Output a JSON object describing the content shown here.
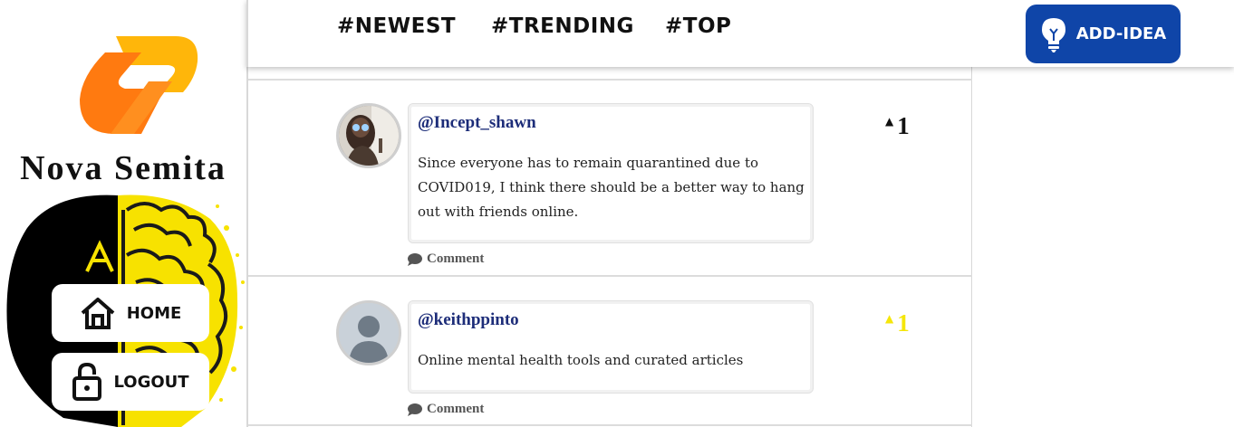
{
  "brand": {
    "name": "Nova Semita"
  },
  "sidebar": {
    "items": [
      {
        "label": "HOME",
        "icon": "home-icon"
      },
      {
        "label": "LOGOUT",
        "icon": "lock-icon"
      }
    ]
  },
  "topbar": {
    "tabs": [
      {
        "label": "#NEWEST"
      },
      {
        "label": "#TRENDING"
      },
      {
        "label": "#TOP"
      }
    ],
    "add_idea_label": "ADD-IDEA"
  },
  "feed": {
    "clipped_comment_label": "Comment",
    "posts": [
      {
        "username": "@Incept_shawn",
        "text": "Since everyone has to remain quarantined due to COVID019, I think there should be a better way to hang out with friends online.",
        "votes": "1",
        "vote_color": "#111111",
        "comment_label": "Comment",
        "avatar": "photo-avatar"
      },
      {
        "username": "@keithppinto",
        "text": "Online mental health tools and curated articles",
        "votes": "1",
        "vote_color": "#f5e60a",
        "comment_label": "Comment",
        "avatar": "default-avatar"
      }
    ]
  },
  "colors": {
    "accent_blue": "#0f45a8",
    "username_blue": "#1d2d79",
    "logo_orange": "#ff7a10",
    "logo_yellow": "#ffb60a",
    "brain_yellow": "#f7e200"
  }
}
